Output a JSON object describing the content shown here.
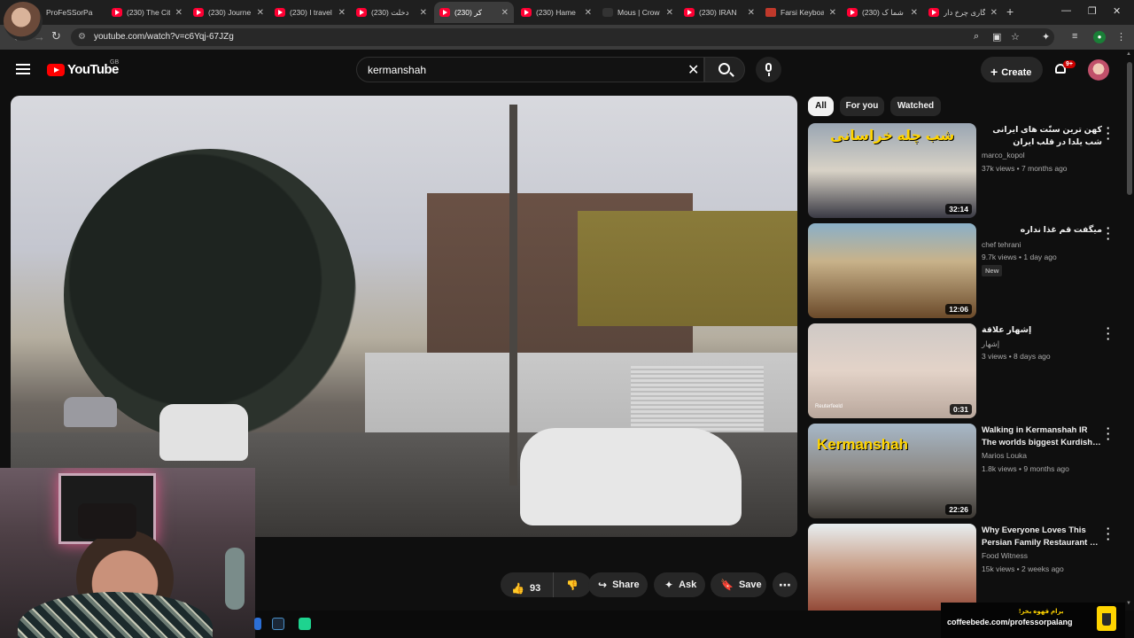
{
  "browser": {
    "tabs": [
      {
        "title": "ProFeSSorPa",
        "icon": "profile-icon",
        "active": false
      },
      {
        "title": "(230) The Cit",
        "icon": "youtube-icon",
        "active": false
      },
      {
        "title": "(230) Journe",
        "icon": "youtube-icon",
        "active": false
      },
      {
        "title": "(230) I travel",
        "icon": "youtube-icon",
        "active": false
      },
      {
        "title": "(230) دخلت",
        "icon": "youtube-icon",
        "active": false
      },
      {
        "title": "(230) کر",
        "icon": "youtube-icon",
        "active": true
      },
      {
        "title": "(230) Hame",
        "icon": "youtube-icon",
        "active": false
      },
      {
        "title": "Mous | Crow",
        "icon": "dark-icon",
        "active": false
      },
      {
        "title": "(230) IRAN",
        "icon": "youtube-icon",
        "active": false
      },
      {
        "title": "Farsi Keyboa",
        "icon": "book-icon",
        "active": false
      },
      {
        "title": "(230) شما ک",
        "icon": "youtube-icon",
        "active": false
      },
      {
        "title": "گاری چرخ دار",
        "icon": "youtube-icon",
        "active": false
      }
    ],
    "new_tab": "+",
    "minimize": "—",
    "maximize": "❐",
    "close": "✕",
    "url": "youtube.com/watch?v=c6Yqj-67JZg",
    "profile_initial": "●"
  },
  "youtube": {
    "logo_text": "YouTube",
    "region": "GB",
    "search_query": "kermanshah",
    "create_label": "Create",
    "notification_count": "9+"
  },
  "actions": {
    "likes": "93",
    "share": "Share",
    "ask": "Ask",
    "save": "Save"
  },
  "chips": [
    "All",
    "For you",
    "Watched"
  ],
  "recommendations": [
    {
      "title": "کهن ترین سنّت های ایرانی شب یلدا در قلب ایران",
      "channel": "marco_kopol",
      "meta": "37k views • 7 months ago",
      "duration": "32:14",
      "badge": "",
      "thumb_text": "شب چله خراسانی"
    },
    {
      "title": "میگفت قم غذا نداره",
      "channel": "chef tehrani",
      "meta": "9.7k views • 1 day ago",
      "duration": "12:06",
      "badge": "New",
      "thumb_text": ""
    },
    {
      "title": "إشهار علاقة",
      "channel": "إشهار",
      "meta": "3 views • 8 days ago",
      "duration": "0:31",
      "badge": "",
      "thumb_text": "Reuterfeeld"
    },
    {
      "title": "Walking in Kermanshah IR The worlds biggest Kurdish…",
      "channel": "Marios Louka",
      "meta": "1.8k views • 9 months ago",
      "duration": "22:26",
      "badge": "",
      "thumb_text": "Kermanshah"
    },
    {
      "title": "Why Everyone Loves This Persian Family Restaurant …",
      "channel": "Food Witness",
      "meta": "15k views • 2 weeks ago",
      "duration": "",
      "badge": "",
      "thumb_text": ""
    }
  ],
  "overlay": {
    "coffee_top": "برام قهوه بخر!",
    "coffee_url": "coffeebede.com/professorpalang"
  }
}
